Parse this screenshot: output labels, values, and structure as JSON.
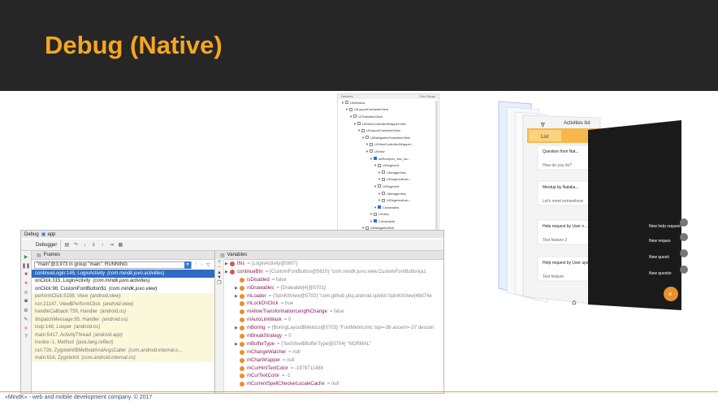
{
  "title": "Debug (Native)",
  "footer": "«MindK» - web and mobile development company. © 2017",
  "tree": {
    "header_left": "Network",
    "header_right": "Zero Steps",
    "nodes": [
      {
        "label": "UIWindow",
        "depth": 0,
        "blue": false
      },
      {
        "label": "UILayoutContainerView",
        "depth": 1,
        "blue": false
      },
      {
        "label": "UITransitionView",
        "depth": 2,
        "blue": false
      },
      {
        "label": "UIViewControllerWrapperView",
        "depth": 3,
        "blue": false
      },
      {
        "label": "UILayoutContainerView",
        "depth": 4,
        "blue": false
      },
      {
        "label": "UINavigationTransitionView",
        "depth": 5,
        "blue": false
      },
      {
        "label": "UIViewControllerWrapper...",
        "depth": 6,
        "blue": false
      },
      {
        "label": "UIView",
        "depth": 6,
        "blue": false
      },
      {
        "label": "strRoot(xxx_sss_iss...",
        "depth": 7,
        "blue": true
      },
      {
        "label": "UISegment",
        "depth": 8,
        "blue": false
      },
      {
        "label": "UIImageView",
        "depth": 9,
        "blue": false
      },
      {
        "label": "UISegmentLab...",
        "depth": 9,
        "blue": false
      },
      {
        "label": "UISegment",
        "depth": 8,
        "blue": false
      },
      {
        "label": "UIImageView",
        "depth": 9,
        "blue": false
      },
      {
        "label": "UISegmentLab...",
        "depth": 9,
        "blue": false
      },
      {
        "label": "Constraints",
        "depth": 8,
        "blue": true
      },
      {
        "label": "UIView",
        "depth": 7,
        "blue": false
      },
      {
        "label": "Constraints",
        "depth": 7,
        "blue": true
      },
      {
        "label": "UINavigationBar",
        "depth": 5,
        "blue": false
      }
    ]
  },
  "debugger": {
    "window_title": "Debug",
    "app_label": "app",
    "tab_label": "Debugger",
    "frames_header": "Frames",
    "variables_header": "Variables",
    "thread_selector": "\"main\"@3,973 in group \"main\": RUNNING",
    "frames": [
      {
        "method": "continueLogin:145, LoginActivity",
        "pkg": "(com.mindk.juvo.activities)",
        "state": "selected"
      },
      {
        "method": "onClick:315, LoginActivity",
        "pkg": "(com.mindk.juvo.activities)",
        "state": "normal"
      },
      {
        "method": "onClick:98, CustomFontButton$1",
        "pkg": "(com.mindk.juvo.view)",
        "state": "normal"
      },
      {
        "method": "performClick:5198, View",
        "pkg": "(android.view)",
        "state": "library"
      },
      {
        "method": "run:21147, View$PerformClick",
        "pkg": "(android.view)",
        "state": "library"
      },
      {
        "method": "handleCallback:739, Handler",
        "pkg": "(android.os)",
        "state": "library"
      },
      {
        "method": "dispatchMessage:95, Handler",
        "pkg": "(android.os)",
        "state": "library"
      },
      {
        "method": "loop:148, Looper",
        "pkg": "(android.os)",
        "state": "library"
      },
      {
        "method": "main:5417, ActivityThread",
        "pkg": "(android.app)",
        "state": "library"
      },
      {
        "method": "invoke:-1, Method",
        "pkg": "(java.lang.reflect)",
        "state": "library"
      },
      {
        "method": "run:726, ZygoteInit$MethodAndArgsCaller",
        "pkg": "(com.android.internal.o...",
        "state": "library"
      },
      {
        "method": "main:616, ZygoteInit",
        "pkg": "(com.android.internal.os)",
        "state": "library"
      }
    ],
    "variables": [
      {
        "name": "this",
        "value": "= {LoginActivity@5607}",
        "icon": "red",
        "expand": true,
        "depth": 0
      },
      {
        "name": "continueBtn",
        "value": "= {CustomFontButton@5610} \"com.mindk.juvo.view.CustomFontButton{a1",
        "icon": "red",
        "expand": true,
        "depth": 0
      },
      {
        "name": "isDisabled",
        "value": "= false",
        "icon": "orange",
        "expand": false,
        "depth": 1
      },
      {
        "name": "mDrawables",
        "value": "= {Drawable[4]@5701}",
        "icon": "orange",
        "expand": true,
        "depth": 1
      },
      {
        "name": "mLoader",
        "value": "= {SpinKitView@5702} \"com.github.ybq.android.spinkit.SpinKitView{48d74e",
        "icon": "orange",
        "expand": true,
        "depth": 1
      },
      {
        "name": "mLockOnClick",
        "value": "= true",
        "icon": "orange",
        "expand": false,
        "depth": 1
      },
      {
        "name": "mAllowTransformationLengthChange",
        "value": "= false",
        "icon": "orange",
        "expand": false,
        "depth": 1
      },
      {
        "name": "mAutoLinkMask",
        "value": "= 0",
        "icon": "orange",
        "expand": false,
        "depth": 1
      },
      {
        "name": "mBoring",
        "value": "= {BoringLayout$Metrics@5703} \"FontMetricsInt: top=-36 ascent=-37 descen",
        "icon": "orange",
        "expand": true,
        "depth": 1
      },
      {
        "name": "mBreakStrategy",
        "value": "= 0",
        "icon": "orange",
        "expand": false,
        "depth": 1
      },
      {
        "name": "mBufferType",
        "value": "= {TextView$BufferType@5704} \"NORMAL\"",
        "icon": "orange",
        "expand": true,
        "depth": 1
      },
      {
        "name": "mChangeWatcher",
        "value": "= null",
        "icon": "orange",
        "expand": false,
        "depth": 1
      },
      {
        "name": "mCharWrapper",
        "value": "= null",
        "icon": "orange",
        "expand": false,
        "depth": 1
      },
      {
        "name": "mCurHintTextColor",
        "value": "= -1979711488",
        "icon": "orange",
        "expand": false,
        "depth": 1
      },
      {
        "name": "mCurTextColor",
        "value": "= -1",
        "icon": "orange",
        "expand": false,
        "depth": 1
      },
      {
        "name": "mCurrentSpellCheckerLocaleCache",
        "value": "= null",
        "icon": "orange",
        "expand": false,
        "depth": 1
      }
    ]
  },
  "view3d": {
    "title": "Activities list",
    "tab_list": "List",
    "cards": [
      "Question from Nat...",
      "How do you do?",
      "Meetup by Natalia...",
      "Let's meet somewhere",
      "Help request by User n...",
      "Test feature 2",
      "Help request by User upd...",
      "Test feature"
    ],
    "dark_items": [
      "New help request",
      "New reques",
      "New questi",
      "New questio"
    ],
    "fab": "×"
  },
  "colors": {
    "header_bg": "#262626",
    "title": "#f5a623",
    "selection": "#2d6bc6",
    "accent": "#e8902c"
  }
}
